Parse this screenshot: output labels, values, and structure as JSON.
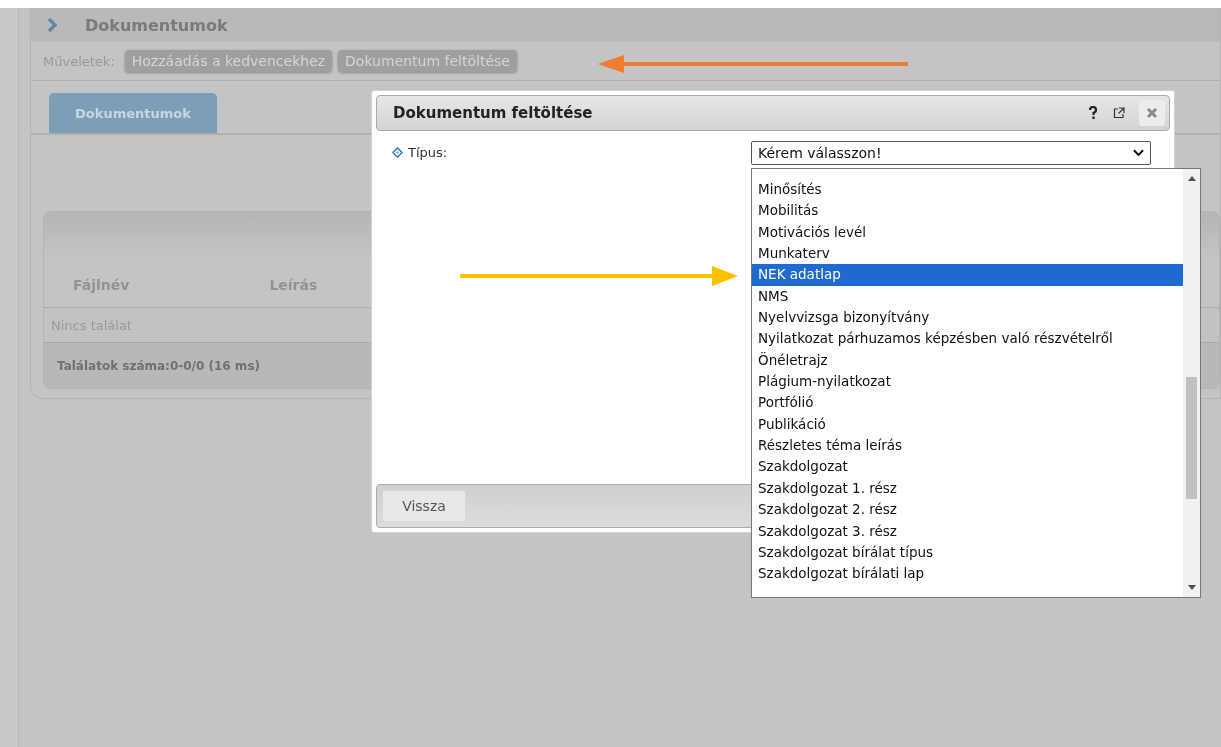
{
  "header": {
    "title": "Dokumentumok"
  },
  "actions": {
    "label": "Műveletek:",
    "buttons": [
      "Hozzáadás a kedvencekhez",
      "Dokumentum feltöltése"
    ]
  },
  "tabs": [
    {
      "label": "Dokumentumok",
      "selected": true
    }
  ],
  "table": {
    "columns": [
      "Fájlnév",
      "Leírás"
    ],
    "empty_text": "Nincs találat",
    "footer": "Találatok száma:0-0/0 (16 ms)"
  },
  "dialog": {
    "title": "Dokumentum feltöltése",
    "field": {
      "label": "Típus:",
      "value": "Kérem válasszon!"
    },
    "buttons": [
      "Vissza"
    ],
    "options": [
      {
        "label": "Minősítés",
        "selected": false
      },
      {
        "label": "Mobilitás",
        "selected": false
      },
      {
        "label": "Motivációs levél",
        "selected": false
      },
      {
        "label": "Munkaterv",
        "selected": false
      },
      {
        "label": "NEK adatlap",
        "selected": true
      },
      {
        "label": "NMS",
        "selected": false
      },
      {
        "label": "Nyelvvizsga bizonyítvány",
        "selected": false
      },
      {
        "label": "Nyilatkozat párhuzamos képzésben való részvételről",
        "selected": false
      },
      {
        "label": "Önéletrajz",
        "selected": false
      },
      {
        "label": "Plágium-nyilatkozat",
        "selected": false
      },
      {
        "label": "Portfólió",
        "selected": false
      },
      {
        "label": "Publikáció",
        "selected": false
      },
      {
        "label": "Részletes téma leírás",
        "selected": false
      },
      {
        "label": "Szakdolgozat",
        "selected": false
      },
      {
        "label": "Szakdolgozat 1. rész",
        "selected": false
      },
      {
        "label": "Szakdolgozat 2. rész",
        "selected": false
      },
      {
        "label": "Szakdolgozat 3. rész",
        "selected": false
      },
      {
        "label": "Szakdolgozat bírálat típus",
        "selected": false
      },
      {
        "label": "Szakdolgozat bírálati lap",
        "selected": false
      }
    ]
  },
  "annotations": [
    {
      "kind": "left-arrow",
      "color": "#ed7d31"
    },
    {
      "kind": "right-arrow",
      "color": "#ffc000"
    }
  ]
}
